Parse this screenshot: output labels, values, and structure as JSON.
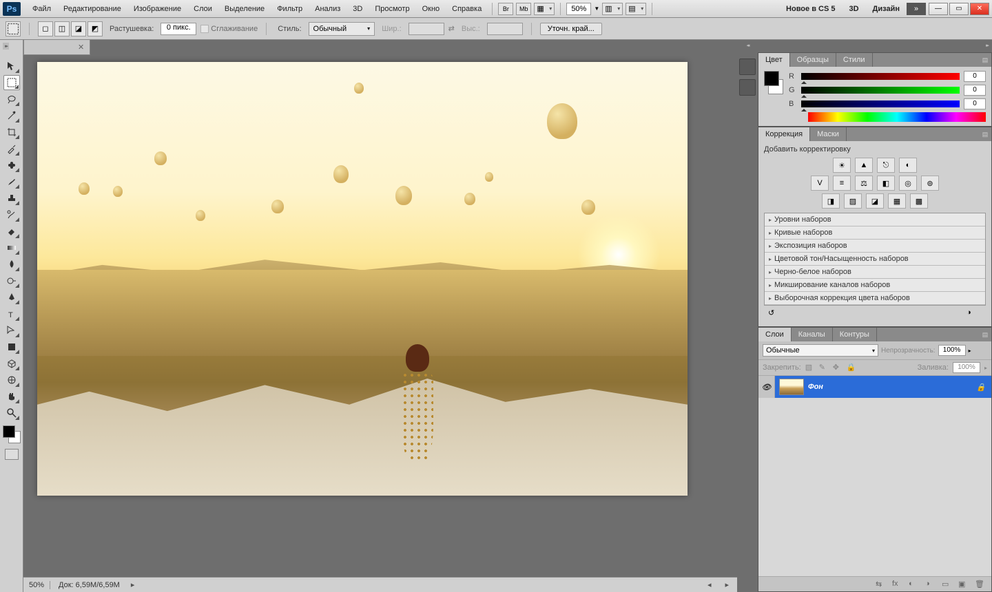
{
  "menu": {
    "items": [
      "Файл",
      "Редактирование",
      "Изображение",
      "Слои",
      "Выделение",
      "Фильтр",
      "Анализ",
      "3D",
      "Просмотр",
      "Окно",
      "Справка"
    ],
    "zoom": "50%",
    "workspace": [
      "Новое в CS 5",
      "3D",
      "Дизайн"
    ]
  },
  "options": {
    "feather_label": "Растушевка:",
    "feather_value": "0 пикс.",
    "antialias": "Сглаживание",
    "style_label": "Стиль:",
    "style_value": "Обычный",
    "width_label": "Шир.:",
    "height_label": "Выс.:",
    "refine": "Уточн. край..."
  },
  "document": {
    "tab_title": ""
  },
  "status": {
    "zoom": "50%",
    "doc": "Док: 6,59M/6,59M"
  },
  "panels": {
    "color": {
      "tabs": [
        "Цвет",
        "Образцы",
        "Стили"
      ],
      "r_label": "R",
      "g_label": "G",
      "b_label": "B",
      "r": "0",
      "g": "0",
      "b": "0"
    },
    "adjust": {
      "tabs": [
        "Коррекция",
        "Маски"
      ],
      "title": "Добавить корректировку",
      "presets": [
        "Уровни наборов",
        "Кривые наборов",
        "Экспозиция наборов",
        "Цветовой тон/Насыщенность наборов",
        "Черно-белое наборов",
        "Микширование каналов наборов",
        "Выборочная коррекция цвета наборов"
      ]
    },
    "layers": {
      "tabs": [
        "Слои",
        "Каналы",
        "Контуры"
      ],
      "blend": "Обычные",
      "opacity_label": "Непрозрачность:",
      "opacity": "100%",
      "lock_label": "Закрепить:",
      "fill_label": "Заливка:",
      "fill": "100%",
      "layer_name": "Фон"
    }
  }
}
